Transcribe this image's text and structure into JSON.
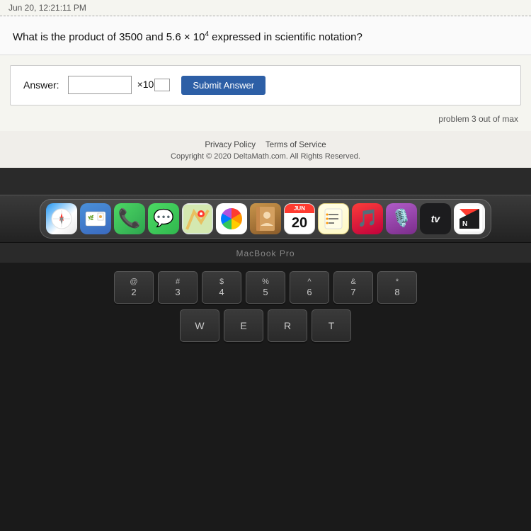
{
  "timestamp": "Jun 20, 12:21:11 PM",
  "question": {
    "text_part1": "What is the product of 3500 and 5.6 × 10",
    "exponent": "4",
    "text_part2": " expressed in scientific notation?"
  },
  "answer": {
    "label": "Answer:",
    "input_placeholder": "",
    "times_label": "×10",
    "submit_label": "Submit Answer"
  },
  "problem_count": "problem 3 out of max",
  "footer": {
    "privacy_policy": "Privacy Policy",
    "terms_of_service": "Terms of Service",
    "copyright": "Copyright © 2020 DeltaMath.com. All Rights Reserved."
  },
  "macbook_label": "MacBook Pro",
  "keyboard": {
    "row1": [
      {
        "top": "@",
        "bottom": "2"
      },
      {
        "top": "#",
        "bottom": "3"
      },
      {
        "top": "$",
        "bottom": "4"
      },
      {
        "top": "%",
        "bottom": "5"
      },
      {
        "top": "^",
        "bottom": "6"
      },
      {
        "top": "&",
        "bottom": "7"
      },
      {
        "top": "*",
        "bottom": "8"
      }
    ],
    "row2_labels": [
      "W",
      "E",
      "R",
      "T"
    ]
  },
  "dock": {
    "icons": [
      {
        "name": "safari",
        "label": "Safari"
      },
      {
        "name": "mail",
        "label": "Mail"
      },
      {
        "name": "phone",
        "label": "Phone"
      },
      {
        "name": "messages",
        "label": "Messages"
      },
      {
        "name": "maps",
        "label": "Maps"
      },
      {
        "name": "photos",
        "label": "Photos"
      },
      {
        "name": "contacts",
        "label": "Contacts"
      },
      {
        "name": "calendar",
        "label": "Calendar",
        "date": "20",
        "month": "JUN"
      },
      {
        "name": "reminders",
        "label": "Reminders"
      },
      {
        "name": "music",
        "label": "Music"
      },
      {
        "name": "podcasts",
        "label": "Podcasts"
      },
      {
        "name": "tv",
        "label": "TV"
      },
      {
        "name": "news",
        "label": "News"
      }
    ]
  }
}
